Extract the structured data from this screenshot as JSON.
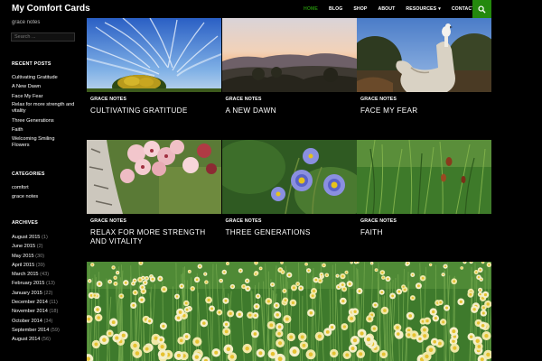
{
  "site": {
    "title": "My Comfort Cards",
    "tagline": "grace notes"
  },
  "nav": {
    "items": [
      {
        "label": "HOME",
        "active": true
      },
      {
        "label": "BLOG"
      },
      {
        "label": "SHOP"
      },
      {
        "label": "ABOUT"
      },
      {
        "label": "RESOURCES",
        "dropdown": true
      },
      {
        "label": "CONTACT"
      }
    ],
    "search_icon": "search-icon"
  },
  "sidebar": {
    "search_placeholder": "Search ...",
    "recent_posts": {
      "title": "RECENT POSTS",
      "items": [
        "Cultivating Gratitude",
        "A New Dawn",
        "Face My Fear",
        "Relax for more strength and vitality",
        "Three Generations",
        "Faith",
        "Welcoming Smiling Flowers"
      ]
    },
    "categories": {
      "title": "CATEGORIES",
      "items": [
        "comfort",
        "grace notes"
      ]
    },
    "archives": {
      "title": "ARCHIVES",
      "items": [
        {
          "month": "August 2015",
          "count": "(1)"
        },
        {
          "month": "June 2015",
          "count": "(2)"
        },
        {
          "month": "May 2015",
          "count": "(30)"
        },
        {
          "month": "April 2015",
          "count": "(39)"
        },
        {
          "month": "March 2015",
          "count": "(43)"
        },
        {
          "month": "February 2015",
          "count": "(13)"
        },
        {
          "month": "January 2015",
          "count": "(22)"
        },
        {
          "month": "December 2014",
          "count": "(11)"
        },
        {
          "month": "November 2014",
          "count": "(18)"
        },
        {
          "month": "October 2014",
          "count": "(34)"
        },
        {
          "month": "September 2014",
          "count": "(59)"
        },
        {
          "month": "August 2014",
          "count": "(56)"
        }
      ]
    }
  },
  "posts": [
    {
      "category": "GRACE NOTES",
      "title": "CULTIVATING GRATITUDE",
      "image": "sky-with-tree"
    },
    {
      "category": "GRACE NOTES",
      "title": "A NEW DAWN",
      "image": "dawn-hills"
    },
    {
      "category": "GRACE NOTES",
      "title": "FACE MY FEAR",
      "image": "bird-on-statue"
    },
    {
      "category": "GRACE NOTES",
      "title": "RELAX FOR MORE STRENGTH AND VITALITY",
      "image": "pink-blossoms"
    },
    {
      "category": "GRACE NOTES",
      "title": "THREE GENERATIONS",
      "image": "blue-daisies"
    },
    {
      "category": "GRACE NOTES",
      "title": "FAITH",
      "image": "grass-buds"
    }
  ],
  "featured": {
    "image": "daffodil-field"
  },
  "colors": {
    "accent": "#24890d",
    "background": "#000000",
    "text": "#ffffff"
  }
}
